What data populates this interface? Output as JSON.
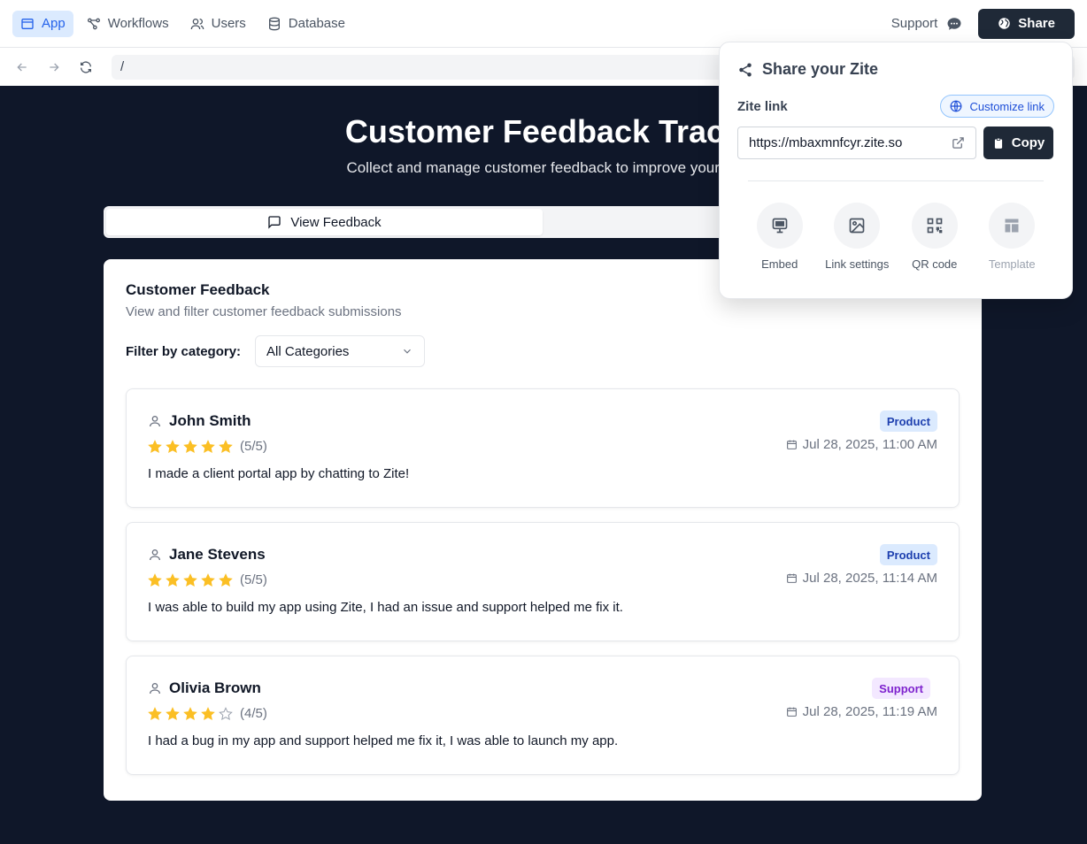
{
  "nav": {
    "tabs": [
      {
        "label": "App",
        "icon": "app-window-icon"
      },
      {
        "label": "Workflows",
        "icon": "workflow-icon"
      },
      {
        "label": "Users",
        "icon": "users-icon"
      },
      {
        "label": "Database",
        "icon": "database-icon"
      }
    ],
    "support_label": "Support",
    "share_label": "Share"
  },
  "browser": {
    "url": "/"
  },
  "app": {
    "title": "Customer Feedback Track",
    "subtitle": "Collect and manage customer feedback to improve your bu",
    "tabs": [
      {
        "label": "View Feedback",
        "active": true
      },
      {
        "label": "",
        "active": false
      }
    ]
  },
  "card": {
    "title": "Customer Feedback",
    "description": "View and filter customer feedback submissions",
    "filter_label": "Filter by category:",
    "filter_value": "All Categories",
    "items": [
      {
        "name": "John Smith",
        "rating": 5,
        "score_text": "(5/5)",
        "category": "Product",
        "date": "Jul 28, 2025, 11:00 AM",
        "comment": "I made a client portal app by chatting to Zite!"
      },
      {
        "name": "Jane Stevens",
        "rating": 5,
        "score_text": "(5/5)",
        "category": "Product",
        "date": "Jul 28, 2025, 11:14 AM",
        "comment": "I was able to build my app using Zite, I had an issue and support helped me fix it."
      },
      {
        "name": "Olivia Brown",
        "rating": 4,
        "score_text": "(4/5)",
        "category": "Support",
        "date": "Jul 28, 2025, 11:19 AM",
        "comment": "I had a bug in my app and support helped me fix it, I was able to launch my app."
      }
    ]
  },
  "share": {
    "title": "Share your Zite",
    "link_label": "Zite link",
    "customize_label": "Customize link",
    "link_value": "https://mbaxmnfcyr.zite.so",
    "copy_label": "Copy",
    "actions": [
      {
        "label": "Embed",
        "icon": "monitor-icon",
        "disabled": false
      },
      {
        "label": "Link settings",
        "icon": "image-icon",
        "disabled": false
      },
      {
        "label": "QR code",
        "icon": "qr-code-icon",
        "disabled": false
      },
      {
        "label": "Template",
        "icon": "template-icon",
        "disabled": true
      }
    ]
  },
  "colors": {
    "page_bg": "#0f1729",
    "accent": "#2563eb",
    "star": "#fbbf24",
    "dark_button": "#1f2937"
  }
}
